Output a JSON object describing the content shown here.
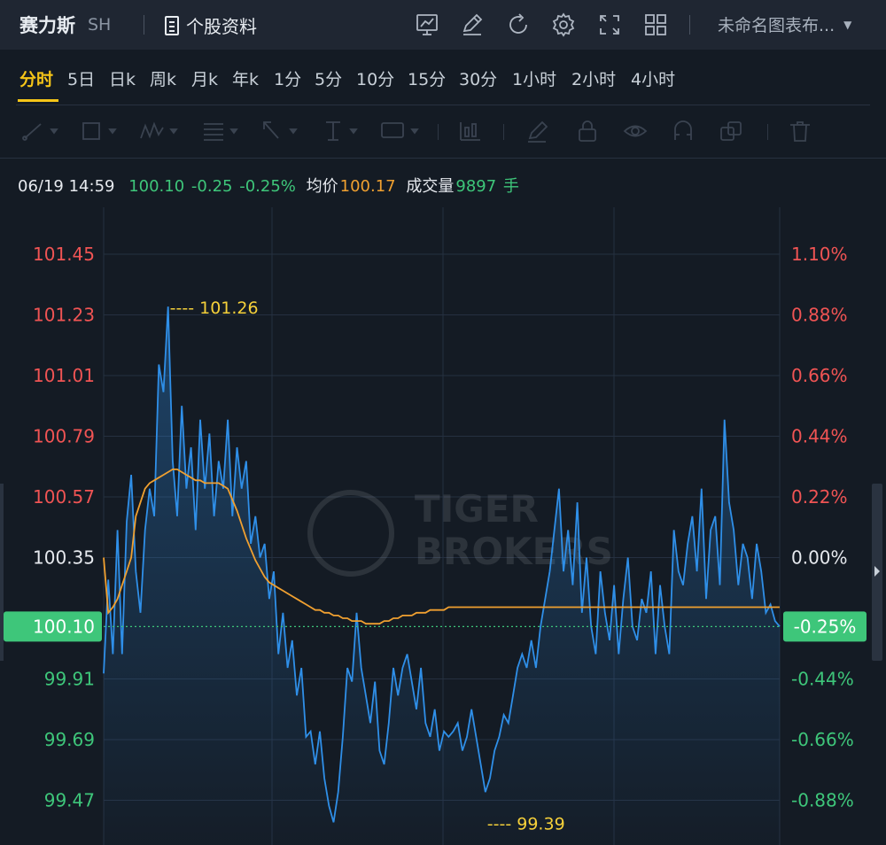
{
  "header": {
    "stock_name": "赛力斯",
    "market": "SH",
    "profile_label": "个股资料",
    "layout_name": "未命名图表布...",
    "icons": [
      "chart-template-icon",
      "draw-pen-icon",
      "refresh-icon",
      "settings-gear-icon",
      "fullscreen-icon",
      "grid-layout-icon"
    ]
  },
  "tabs": [
    "分时",
    "5日",
    "日k",
    "周k",
    "月k",
    "年k",
    "1分",
    "5分",
    "10分",
    "15分",
    "30分",
    "1小时",
    "2小时",
    "4小时"
  ],
  "active_tab": "分时",
  "info": {
    "datetime": "06/19 14:59",
    "price": "100.10",
    "change": "-0.25",
    "change_pct": "-0.25%",
    "avg_label": "均价",
    "avg_value": "100.17",
    "volume_label": "成交量",
    "volume_value": "9897",
    "volume_unit": "手"
  },
  "colors": {
    "up": "#f05454",
    "down": "#3ec67a",
    "neutral": "#e6e9ee",
    "price_line": "#2f8fe8",
    "avg_line": "#f0a030",
    "marker": "#f5d03a",
    "current_badge": "#3ec67a"
  },
  "watermark": [
    "TIGER",
    "BROKERS"
  ],
  "chart_data": {
    "type": "line",
    "prev_close": 100.35,
    "ylim": [
      99.39,
      101.61
    ],
    "left_ticks": [
      "101.45",
      "101.23",
      "101.01",
      "100.79",
      "100.57",
      "100.35",
      "99.91",
      "99.69",
      "99.47"
    ],
    "left_tick_values": [
      101.45,
      101.23,
      101.01,
      100.79,
      100.57,
      100.35,
      99.91,
      99.69,
      99.47
    ],
    "right_ticks": [
      "1.10%",
      "0.88%",
      "0.66%",
      "0.44%",
      "0.22%",
      "0.00%",
      "-0.44%",
      "-0.66%",
      "-0.88%"
    ],
    "current_price_label": "100.10",
    "current_pct_label": "-0.25%",
    "current_price": 100.1,
    "high_label": "---- 101.26",
    "high_value": 101.26,
    "high_index": 14,
    "low_label": "---- 99.39",
    "low_value": 99.39,
    "low_index": 83,
    "series": [
      {
        "values": [
          99.93,
          100.27,
          100.0,
          100.45,
          100.0,
          100.48,
          100.65,
          100.3,
          100.15,
          100.45,
          100.6,
          100.5,
          101.05,
          100.95,
          101.26,
          100.7,
          100.5,
          100.9,
          100.6,
          100.75,
          100.45,
          100.85,
          100.6,
          100.8,
          100.5,
          100.7,
          100.6,
          100.85,
          100.5,
          100.75,
          100.6,
          100.7,
          100.4,
          100.5,
          100.35,
          100.4,
          100.2,
          100.3,
          100.0,
          100.15,
          99.95,
          100.05,
          99.85,
          99.95,
          99.7,
          99.72,
          99.6,
          99.72,
          99.55,
          99.45,
          99.39,
          99.5,
          99.7,
          99.95,
          99.9,
          100.15,
          99.95,
          99.85,
          99.75,
          99.9,
          99.65,
          99.6,
          99.75,
          99.95,
          99.85,
          99.95,
          100.0,
          99.9,
          99.8,
          99.95,
          99.75,
          99.7,
          99.8,
          99.65,
          99.72,
          99.7,
          99.72,
          99.75,
          99.65,
          99.7,
          99.8,
          99.7,
          99.6,
          99.5,
          99.55,
          99.65,
          99.7,
          99.78,
          99.75,
          99.85,
          99.95,
          100.0,
          99.95,
          100.05,
          99.95,
          100.1,
          100.2,
          100.3,
          100.45,
          100.6,
          100.3,
          100.45,
          100.25,
          100.55,
          100.15,
          100.35,
          100.1,
          100.0,
          100.3,
          100.15,
          100.05,
          100.25,
          100.0,
          100.2,
          100.35,
          100.1,
          100.05,
          100.2,
          100.15,
          100.3,
          100.0,
          100.25,
          100.1,
          100.0,
          100.45,
          100.3,
          100.25,
          100.4,
          100.5,
          100.3,
          100.6,
          100.2,
          100.45,
          100.5,
          100.25,
          100.85,
          100.55,
          100.45,
          100.25,
          100.4,
          100.35,
          100.2,
          100.4,
          100.3,
          100.15,
          100.18,
          100.12,
          100.1
        ],
        "avg": [
          100.35,
          100.15,
          100.17,
          100.2,
          100.25,
          100.3,
          100.35,
          100.5,
          100.55,
          100.6,
          100.62,
          100.63,
          100.64,
          100.65,
          100.66,
          100.67,
          100.67,
          100.66,
          100.65,
          100.64,
          100.63,
          100.63,
          100.62,
          100.62,
          100.62,
          100.62,
          100.61,
          100.6,
          100.56,
          100.52,
          100.47,
          100.42,
          100.38,
          100.34,
          100.31,
          100.28,
          100.26,
          100.25,
          100.24,
          100.23,
          100.22,
          100.21,
          100.2,
          100.19,
          100.18,
          100.17,
          100.16,
          100.16,
          100.15,
          100.15,
          100.14,
          100.14,
          100.13,
          100.13,
          100.12,
          100.12,
          100.12,
          100.11,
          100.11,
          100.11,
          100.11,
          100.12,
          100.12,
          100.13,
          100.13,
          100.14,
          100.14,
          100.14,
          100.15,
          100.15,
          100.15,
          100.16,
          100.16,
          100.16,
          100.16,
          100.17,
          100.17,
          100.17,
          100.17,
          100.17,
          100.17,
          100.17,
          100.17,
          100.17,
          100.17,
          100.17,
          100.17,
          100.17,
          100.17,
          100.17,
          100.17,
          100.17,
          100.17,
          100.17,
          100.17,
          100.17,
          100.17,
          100.17,
          100.17,
          100.17,
          100.17,
          100.17,
          100.17,
          100.17,
          100.17,
          100.17,
          100.17,
          100.17,
          100.17,
          100.17,
          100.17,
          100.17,
          100.17,
          100.17,
          100.17,
          100.17,
          100.17,
          100.17,
          100.17,
          100.17,
          100.17,
          100.17,
          100.17,
          100.17,
          100.17,
          100.17,
          100.17,
          100.17,
          100.17,
          100.17,
          100.17,
          100.17,
          100.17,
          100.17,
          100.17,
          100.17,
          100.17,
          100.17,
          100.17,
          100.17,
          100.17,
          100.17,
          100.17,
          100.17,
          100.17,
          100.17,
          100.17,
          100.17
        ]
      }
    ]
  }
}
